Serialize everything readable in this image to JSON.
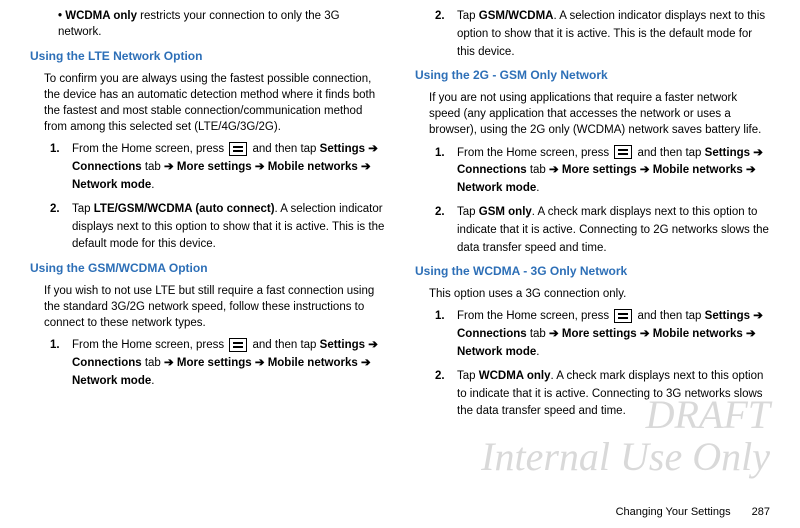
{
  "left": {
    "bullet": {
      "bold": "• WCDMA only",
      "rest": " restricts your connection to only the 3G network."
    },
    "head1": "Using the LTE Network Option",
    "para1": "To confirm you are always using the fastest possible connection, the device has an automatic detection method where it finds both the fastest and most stable connection/communication method from among this selected set (LTE/4G/3G/2G).",
    "step1a_pre": "From the Home screen, press ",
    "step1a_post": " and then tap ",
    "navline": "Settings ➔ Connections tab ➔ More settings ➔ Mobile networks ➔ Network mode",
    "step2a_pre": "Tap ",
    "step2a_bold": "LTE/GSM/WCDMA (auto connect)",
    "step2a_post": ". A selection indicator displays next to this option to show that it is active. This is the default mode for this device.",
    "head2": "Using the GSM/WCDMA Option",
    "para2": "If you wish to not use LTE but still require a fast connection using the standard 3G/2G network speed, follow these instructions to connect to these network types."
  },
  "right": {
    "step2top_pre": "Tap ",
    "step2top_bold": "GSM/WCDMA",
    "step2top_post": ". A selection indicator displays next to this option to show that it is active. This is the default mode for this device.",
    "head1": "Using the 2G - GSM Only Network",
    "para1": "If you are not using applications that require a faster network speed (any application that accesses the network or uses a browser), using the 2G only (WCDMA) network saves battery life.",
    "step2a_bold": "GSM only",
    "step2a_post": ". A check mark displays next to this option to indicate that it is active. Connecting to 2G networks slows the data transfer speed and time.",
    "head2": "Using the WCDMA - 3G Only Network",
    "para2": "This option uses a 3G connection only.",
    "step2b_bold": "WCDMA only",
    "step2b_post": ". A check mark displays next to this option to indicate that it is active. Connecting to 3G networks slows the data transfer speed and time."
  },
  "nav": {
    "settings": "Settings",
    "arrow": "➔",
    "connections": "Connections",
    "tab": " tab ",
    "more": "More settings",
    "mobile": "Mobile networks",
    "mode": "Network mode",
    "period": "."
  },
  "common": {
    "from_home_pre": "From the Home screen, press ",
    "from_home_post": " and then tap ",
    "tap": "Tap "
  },
  "watermark": {
    "l1": "DRAFT",
    "l2": "Internal Use Only"
  },
  "footer": {
    "title": "Changing Your Settings",
    "page": "287"
  }
}
